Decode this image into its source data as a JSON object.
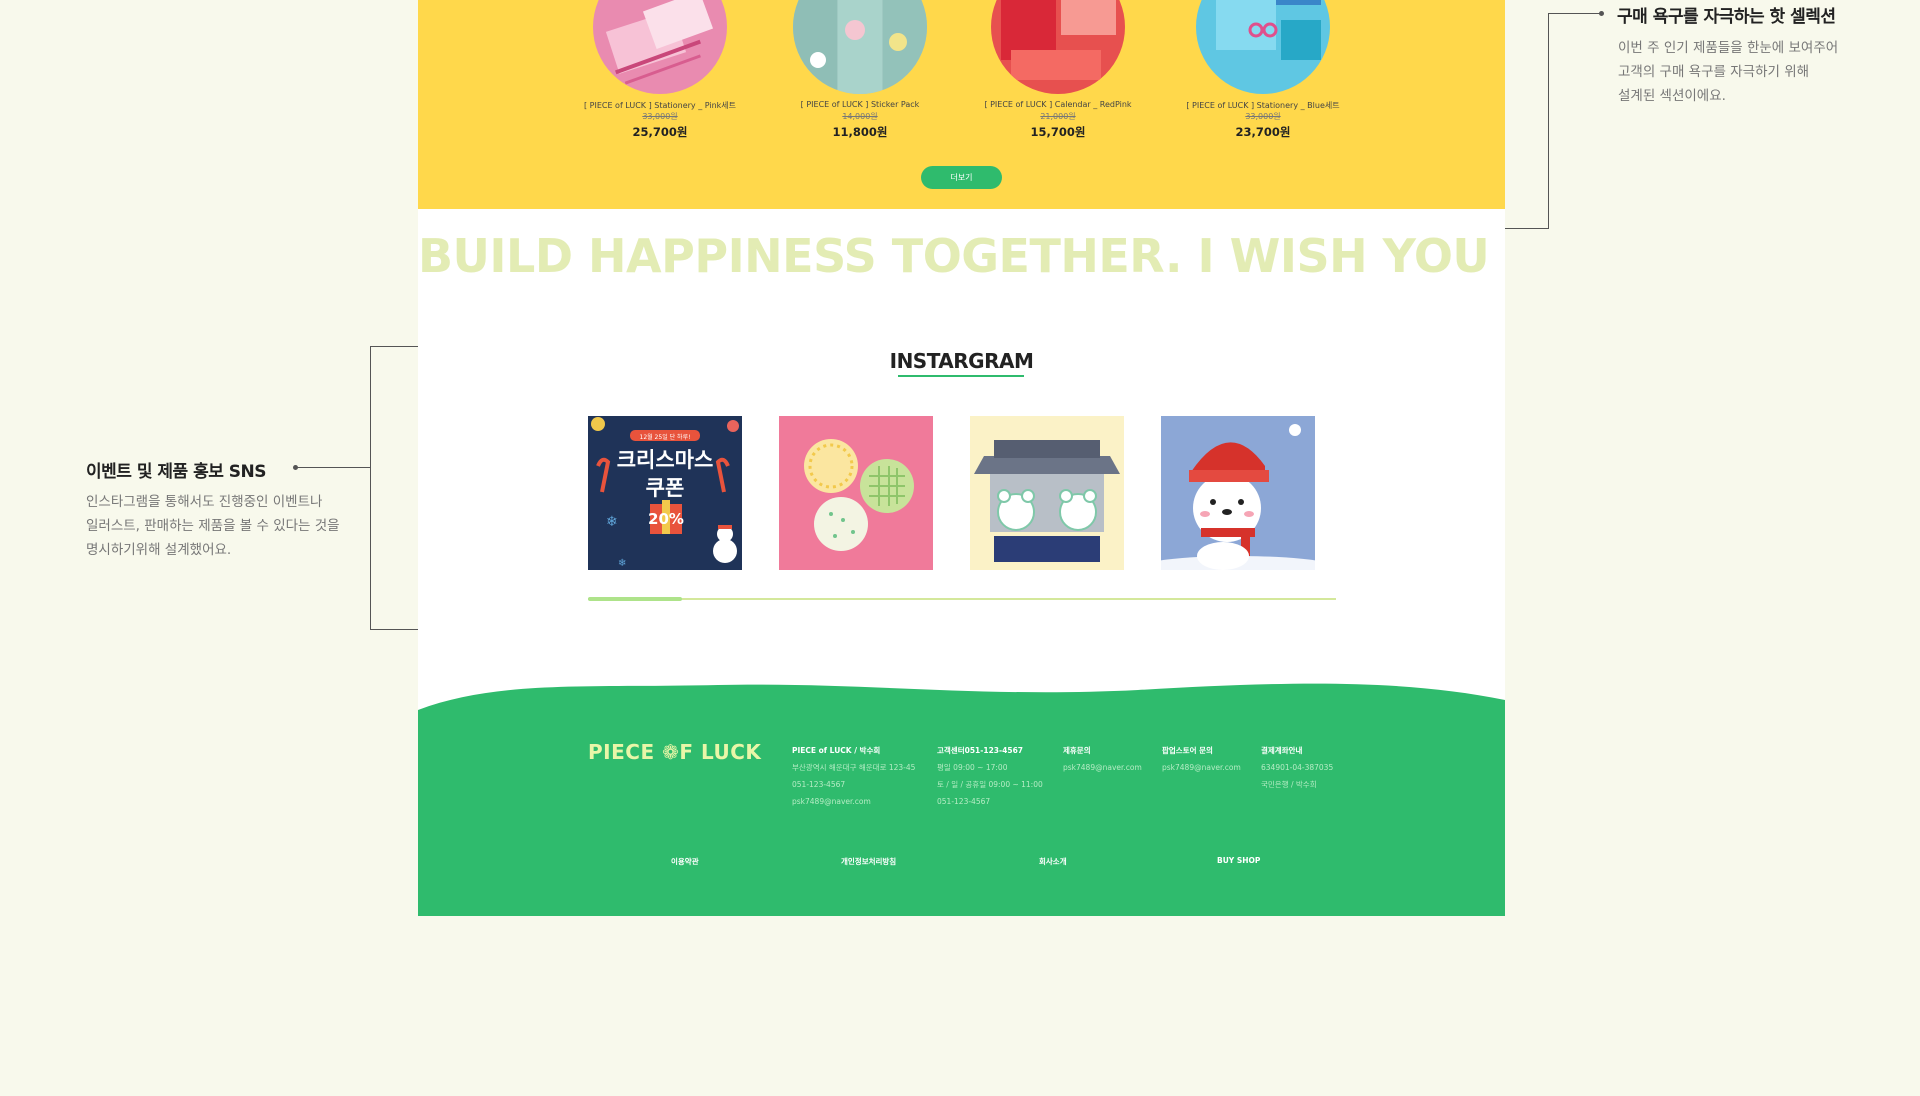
{
  "products": [
    {
      "name": "[ PIECE of LUCK ] Stationery _ Pink세트",
      "old_price": "33,000원",
      "price": "25,700원",
      "thumb_icon": "pink-stationery-photo"
    },
    {
      "name": "[ PIECE of LUCK ] Sticker Pack",
      "old_price": "14,000원",
      "price": "11,800원",
      "thumb_icon": "sticker-locker-photo"
    },
    {
      "name": "[ PIECE of LUCK ] Calendar _ RedPink",
      "old_price": "21,000원",
      "price": "15,700원",
      "thumb_icon": "red-calendar-photo"
    },
    {
      "name": "[ PIECE of LUCK ] Stationery _ Blue세트",
      "old_price": "33,000원",
      "price": "23,700원",
      "thumb_icon": "blue-stationery-photo"
    }
  ],
  "more_button": "더보기",
  "slogan": "BUILD HAPPINESS TOGETHER. I WISH YOU",
  "instagram": {
    "title": "INSTARGRAM",
    "post1": {
      "banner": "12월 25일 단 하루!",
      "line1": "크리스마스",
      "line2": "쿠폰",
      "discount": "20%"
    },
    "posts_icons": [
      "christmas-coupon-image",
      "coasters-image",
      "bears-hanok-image",
      "snowman-bear-image"
    ],
    "scroll_progress": 0.125
  },
  "footer": {
    "logo": "PIECE ❁F LUCK",
    "columns": [
      {
        "head": "PIECE of LUCK / 박수희",
        "lines": [
          "부산광역시 해운대구 해운대로 123-45",
          "051-123-4567",
          "psk7489@naver.com"
        ]
      },
      {
        "head": "고객센터051-123-4567",
        "lines": [
          "평일 09:00 ~ 17:00",
          "토 / 일 / 공휴일 09:00 ~ 11:00",
          "051-123-4567"
        ]
      },
      {
        "head": "제휴문의",
        "lines": [
          "psk7489@naver.com"
        ]
      },
      {
        "head": "팝업스토어 문의",
        "lines": [
          "psk7489@naver.com"
        ]
      },
      {
        "head": "결제계좌안내",
        "lines": [
          "634901-04-387035",
          "국민은행 / 박수희"
        ]
      }
    ],
    "links": [
      "이용약관",
      "개인정보처리방침",
      "회사소개",
      "BUY SHOP"
    ]
  },
  "annotations": {
    "right": {
      "title": "구매 욕구를 자극하는 핫 셀렉션",
      "lines": [
        "이번 주 인기 제품들을 한눈에 보여주어",
        "고객의 구매 욕구를 자극하기 위해",
        "설계된 섹션이에요."
      ]
    },
    "left": {
      "title": "이벤트 및 제품 홍보 SNS",
      "lines": [
        "인스타그램을 통해서도 진행중인 이벤트나",
        "일러스트, 판매하는 제품을 볼 수 있다는 것을",
        "명시하기위해 설계했어요."
      ]
    }
  },
  "colors": {
    "yellow": "#ffd84b",
    "green": "#2fbb6d",
    "background": "#f8f9ec",
    "slogan": "#e3ecb4"
  }
}
